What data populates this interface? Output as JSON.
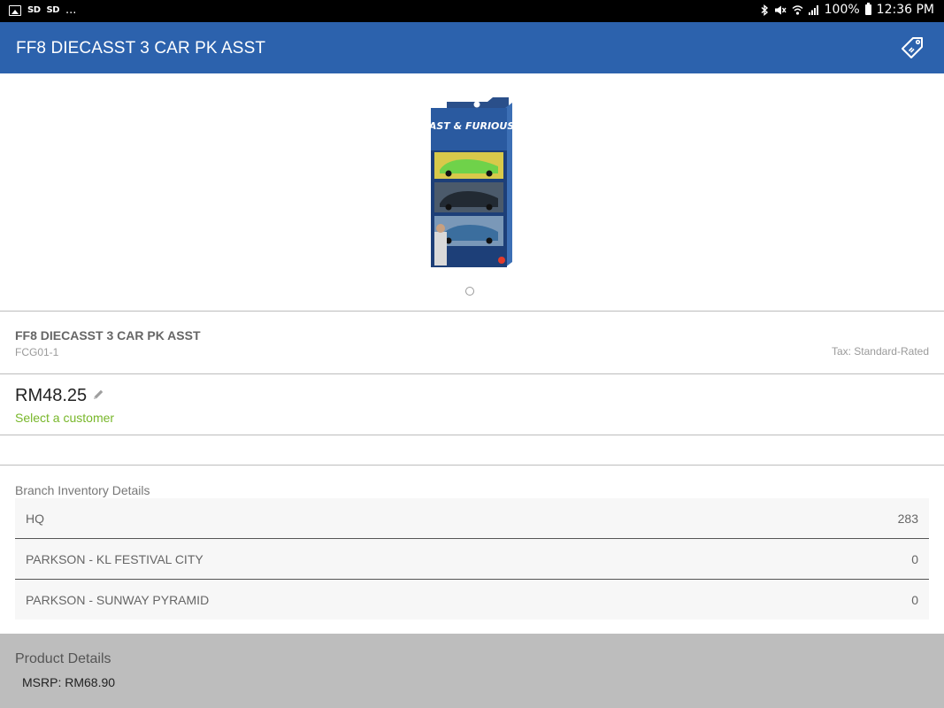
{
  "status_bar": {
    "left_icons": [
      "image-icon",
      "sd-card-icon",
      "sd-card-icon",
      "more-dots-icon"
    ],
    "ellipsis": "...",
    "battery": "100%",
    "time": "12:36 PM"
  },
  "app_bar": {
    "title": "FF8 DIECASST 3 CAR PK ASST",
    "action_icon": "price-tag-icon"
  },
  "product_image": {
    "box_brand": "FAST & FURIOUS",
    "page_count": 1,
    "current_page": 1
  },
  "product": {
    "name": "FF8 DIECASST 3 CAR PK ASST",
    "sku": "FCG01-1",
    "tax": "Tax: Standard-Rated",
    "price": "RM48.25",
    "select_customer": "Select a customer"
  },
  "inventory": {
    "label": "Branch Inventory Details",
    "rows": [
      {
        "branch": "HQ",
        "qty": "283"
      },
      {
        "branch": "PARKSON - KL FESTIVAL CITY",
        "qty": "0"
      },
      {
        "branch": "PARKSON - SUNWAY PYRAMID",
        "qty": "0"
      }
    ]
  },
  "details": {
    "title": "Product Details",
    "msrp": "MSRP: RM68.90"
  },
  "colors": {
    "app_bar": "#2c62ad",
    "link_green": "#78b72a",
    "details_bg": "#bdbdbd"
  }
}
